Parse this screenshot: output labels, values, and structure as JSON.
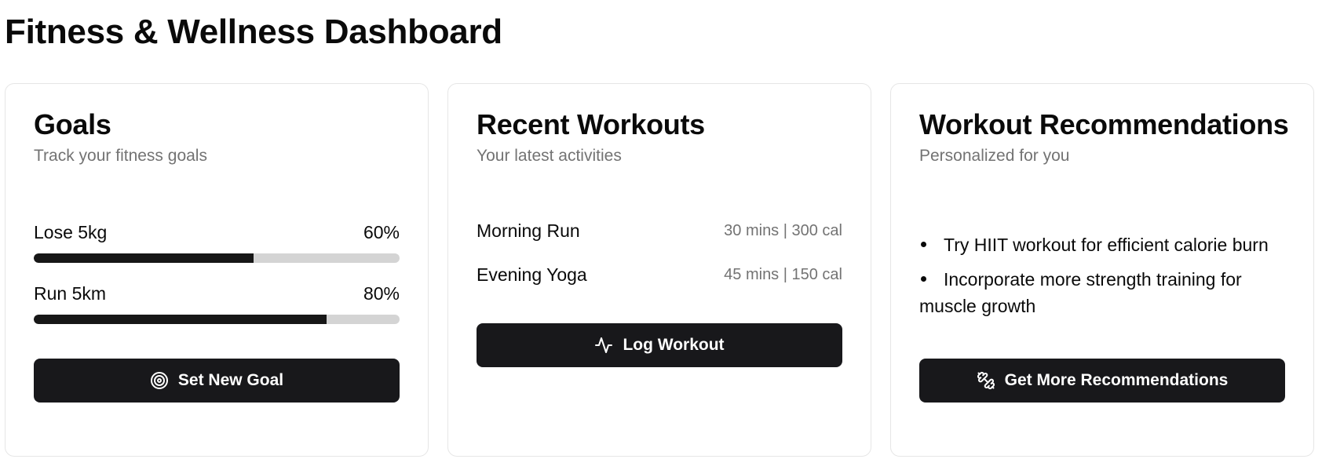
{
  "page": {
    "title": "Fitness & Wellness Dashboard"
  },
  "goals": {
    "title": "Goals",
    "subtitle": "Track your fitness goals",
    "items": [
      {
        "label": "Lose 5kg",
        "percent_label": "60%",
        "progress": 0.6
      },
      {
        "label": "Run 5km",
        "percent_label": "80%",
        "progress": 0.8
      }
    ],
    "button_label": "Set New Goal",
    "button_icon": "target-icon"
  },
  "workouts": {
    "title": "Recent Workouts",
    "subtitle": "Your latest activities",
    "items": [
      {
        "name": "Morning Run",
        "meta": "30 mins | 300 cal"
      },
      {
        "name": "Evening Yoga",
        "meta": "45 mins | 150 cal"
      }
    ],
    "button_label": "Log Workout",
    "button_icon": "activity-icon"
  },
  "recommendations": {
    "title": "Workout Recommendations",
    "subtitle": "Personalized for you",
    "items": [
      "Try HIIT workout for efficient calorie burn",
      "Incorporate more strength training for muscle growth"
    ],
    "button_label": "Get More Recommendations",
    "button_icon": "dumbbell-icon"
  },
  "colors": {
    "primary": "#18181b",
    "muted_text": "#737373",
    "track": "#d4d4d4",
    "border": "#e6e6e6"
  }
}
